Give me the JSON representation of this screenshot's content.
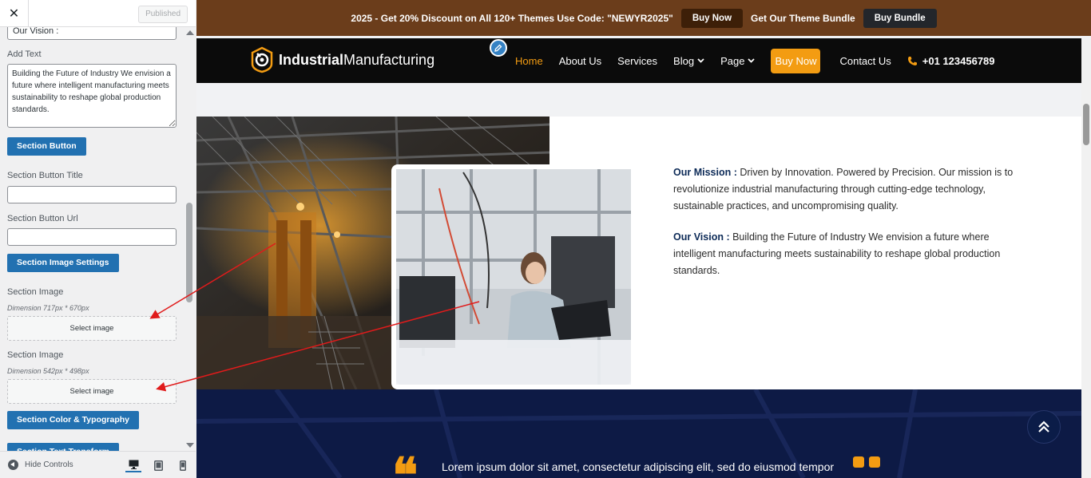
{
  "customizer": {
    "close_label": "✕",
    "published_label": "Published",
    "vision_field_value": "Our Vision :",
    "add_text_label": "Add Text",
    "add_text_value": "Building the Future of Industry We envision a future where intelligent manufacturing meets sustainability to reshape global production standards.",
    "section_button_label": "Section Button",
    "button_title_label": "Section Button Title",
    "button_title_value": "",
    "button_url_label": "Section Button Url",
    "button_url_value": "",
    "image_settings_label": "Section Image Settings",
    "image1_label": "Section Image",
    "image1_dimension": "Dimension 717px * 670px",
    "image1_select": "Select image",
    "image2_label": "Section Image",
    "image2_dimension": "Dimension 542px * 498px",
    "image2_select": "Select image",
    "color_typography_label": "Section Color & Typography",
    "text_transform_label": "Section Text Transform",
    "hide_controls_label": "Hide Controls",
    "accent_color": "#2271b1"
  },
  "promo": {
    "text": "2025 - Get 20% Discount on All 120+ Themes Use Code: \"NEWYR2025\"",
    "buy_now": "Buy Now",
    "bundle_text": "Get Our Theme Bundle",
    "buy_bundle": "Buy Bundle"
  },
  "header": {
    "logo_bold": "Industrial",
    "logo_light": "Manufacturing",
    "nav": {
      "home": "Home",
      "about": "About Us",
      "services": "Services",
      "blog": "Blog",
      "page": "Page",
      "buy_now": "Buy Now",
      "contact": "Contact Us",
      "phone": "+01 123456789"
    },
    "accent_color": "#f39c12"
  },
  "about": {
    "mission_label": "Our Mission :",
    "mission_text": " Driven by Innovation. Powered by Precision. Our mission is to revolutionize industrial manufacturing through cutting-edge technology, sustainable practices, and uncompromising quality.",
    "vision_label": "Our Vision :",
    "vision_text": " Building the Future of Industry We envision a future where intelligent manufacturing meets sustainability to reshape global production standards."
  },
  "testimonial": {
    "text": "Lorem ipsum dolor sit amet, consectetur adipiscing elit, sed do eiusmod tempor"
  }
}
